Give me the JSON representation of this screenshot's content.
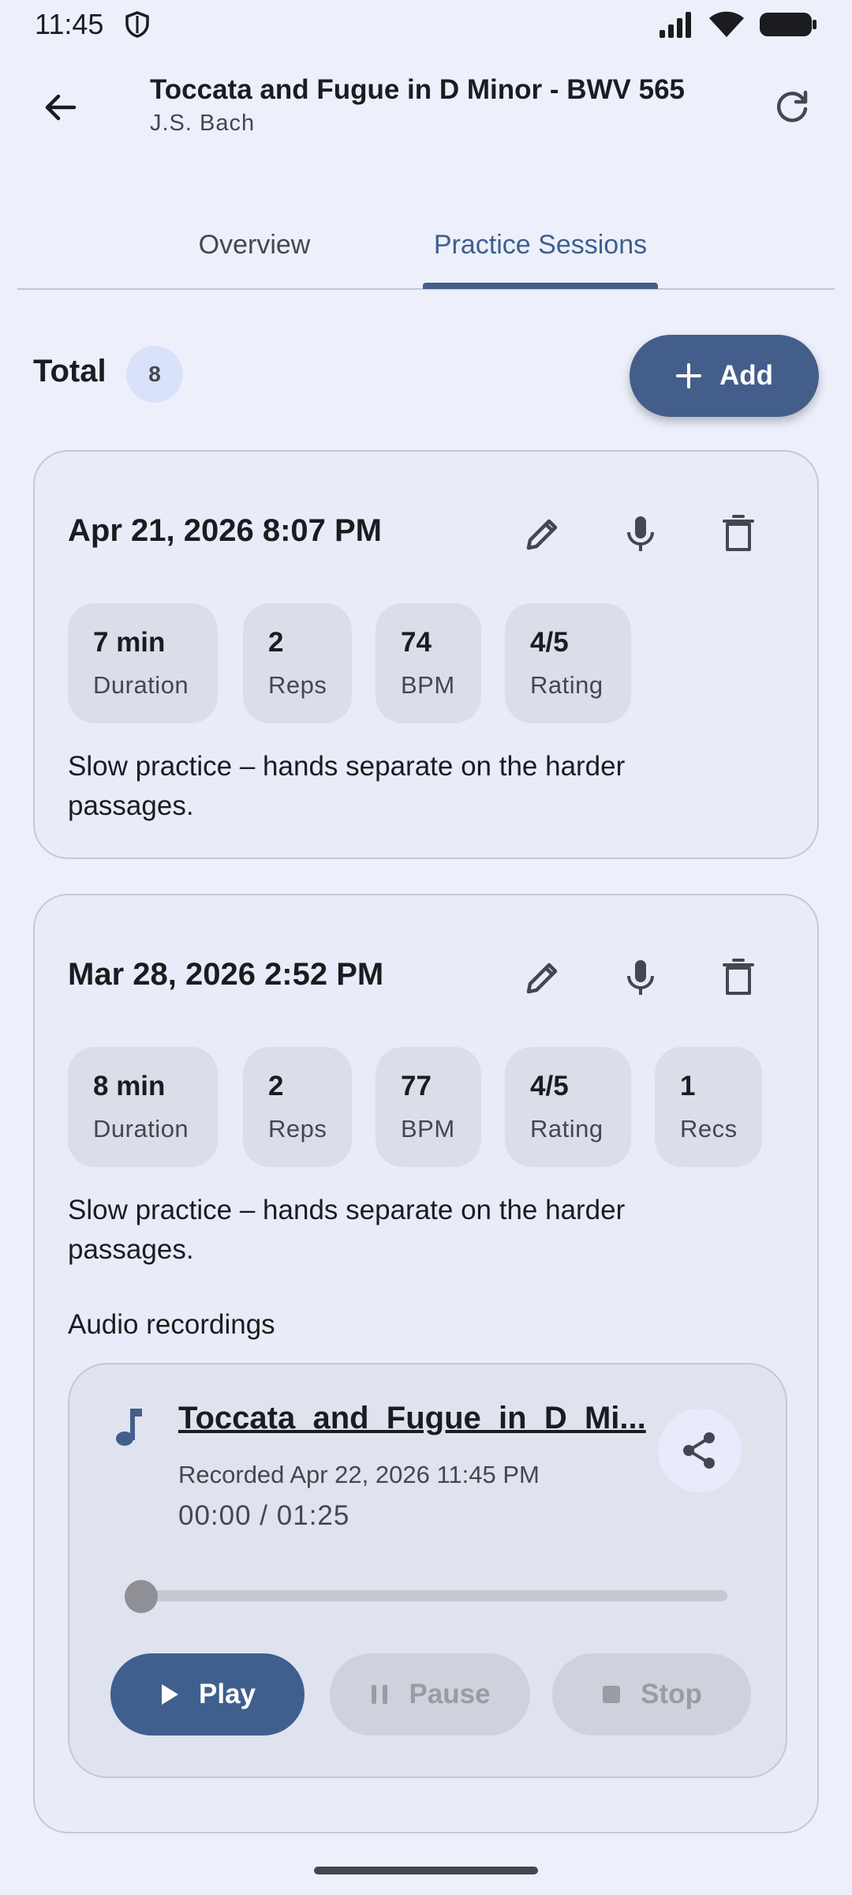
{
  "status_bar": {
    "time": "11:45"
  },
  "app_bar": {
    "title": "Toccata and Fugue in D Minor - BWV 565",
    "subtitle": "J.S. Bach"
  },
  "tabs": [
    {
      "label": "Overview",
      "selected": false
    },
    {
      "label": "Practice Sessions",
      "selected": true
    }
  ],
  "summary": {
    "total_label": "Total",
    "total_count": "8",
    "add_label": "Add"
  },
  "sessions": [
    {
      "date": "Apr 21, 2026 8:07 PM",
      "stats": [
        {
          "value": "7 min",
          "label": "Duration"
        },
        {
          "value": "2",
          "label": "Reps"
        },
        {
          "value": "74",
          "label": "BPM"
        },
        {
          "value": "4/5",
          "label": "Rating"
        }
      ],
      "notes": "Slow practice – hands separate on the harder passages."
    },
    {
      "date": "Mar 28, 2026 2:52 PM",
      "stats": [
        {
          "value": "8 min",
          "label": "Duration"
        },
        {
          "value": "2",
          "label": "Reps"
        },
        {
          "value": "77",
          "label": "BPM"
        },
        {
          "value": "4/5",
          "label": "Rating"
        },
        {
          "value": "1",
          "label": "Recs"
        }
      ],
      "notes": "Slow practice – hands separate on the harder passages.",
      "audio_heading": "Audio recordings",
      "recording": {
        "file_name": "Toccata_and_Fugue_in_D_Mi...",
        "recorded": "Recorded Apr 22, 2026 11:45 PM",
        "position": "00:00 / 01:25",
        "progress": 0,
        "play_label": "Play",
        "pause_label": "Pause",
        "stop_label": "Stop"
      }
    }
  ],
  "colors": {
    "accent": "#445e8c",
    "background": "#edf0fb",
    "card": "#e9ecf8",
    "chip": "#dadee9"
  }
}
